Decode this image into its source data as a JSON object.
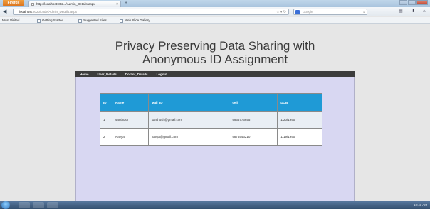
{
  "browser": {
    "menu_button": "Firefox",
    "tab_title": "http://localhost:802.../Admin_Details.aspx",
    "url_host": "localhost",
    "url_rest": ":8020/code/Admin_Details.aspx",
    "search_placeholder": "Google",
    "bookmarks": [
      "Most Visited",
      "Getting Started",
      "Suggested Sites",
      "Web Slice Gallery"
    ]
  },
  "page": {
    "title": "Privacy Preserving Data Sharing with Anonymous ID Assignment",
    "menu": [
      "Home",
      "User_Details",
      "Doctor_Details",
      "Logout"
    ]
  },
  "table": {
    "columns": [
      "ID",
      "Name",
      "Mail_ID",
      "cell",
      "DOB"
    ],
    "rows": [
      [
        "1",
        "santhosh",
        "santhosh@gmail.com",
        "9966776655",
        "1/20/1990"
      ],
      [
        "2",
        "Navya",
        "navya@gmail.com",
        "9876543210",
        "1/19/1990"
      ]
    ]
  },
  "taskbar": {
    "clock": "10:43 AM"
  },
  "colors": {
    "header_blue": "#1f9ad6",
    "content_lavender": "#d8d7f2",
    "menu_dark": "#3c3c3c"
  }
}
